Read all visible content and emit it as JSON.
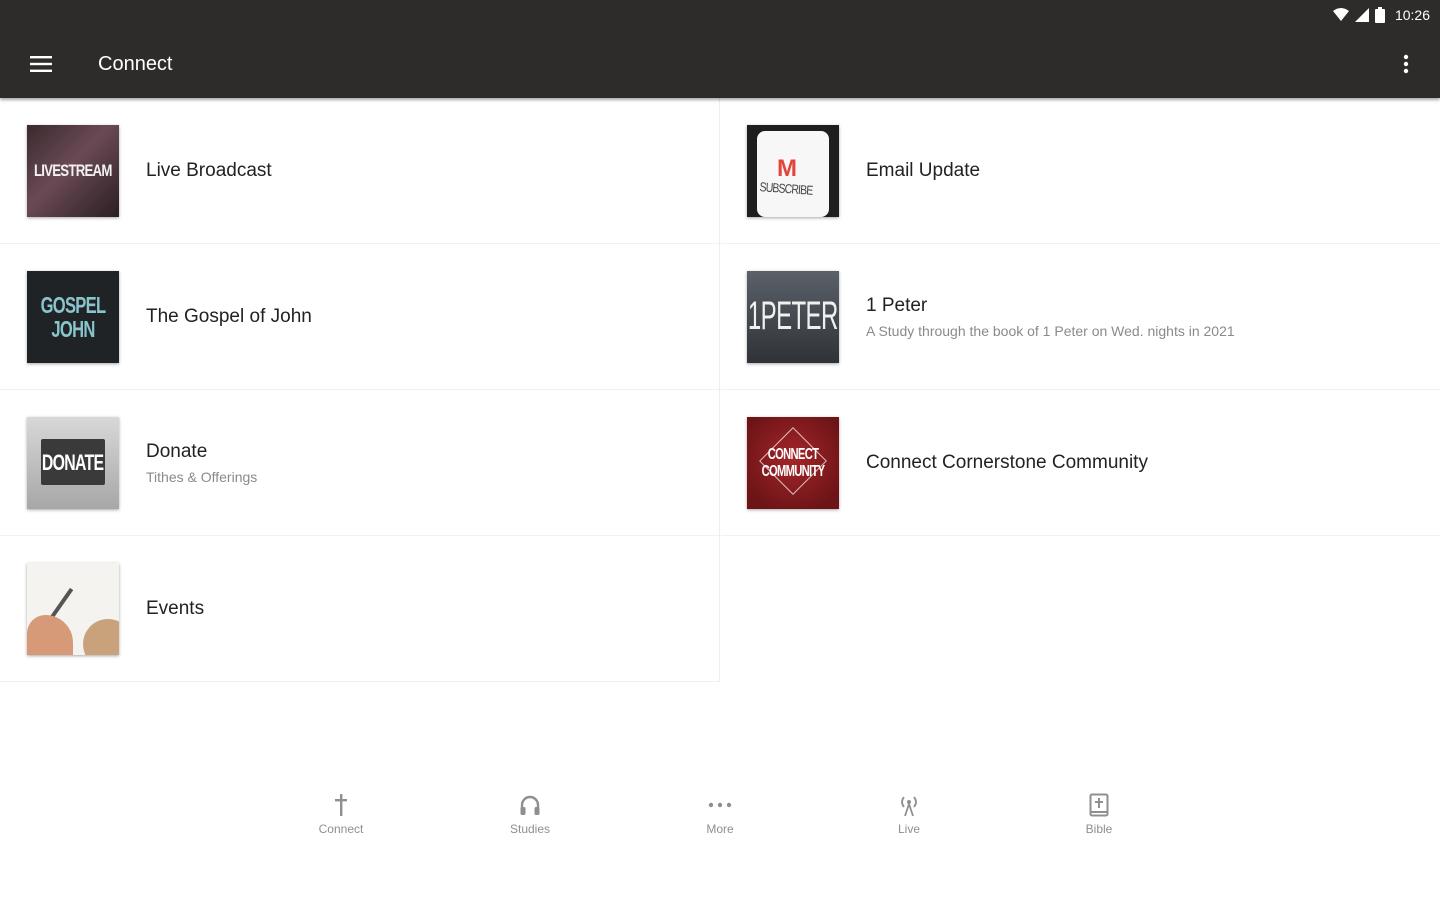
{
  "status_bar": {
    "time": "10:26"
  },
  "app_bar": {
    "title": "Connect",
    "menu_icon": "hamburger-menu-icon",
    "overflow_icon": "more-vertical-icon"
  },
  "items_left": [
    {
      "title": "Live Broadcast",
      "subtitle": "",
      "thumb_text": "LIVESTREAM"
    },
    {
      "title": "The Gospel of John",
      "subtitle": "",
      "thumb_text": "GOSPEL JOHN"
    },
    {
      "title": "Donate",
      "subtitle": "Tithes & Offerings",
      "thumb_text": "DONATE"
    },
    {
      "title": "Events",
      "subtitle": "",
      "thumb_text": ""
    }
  ],
  "items_right": [
    {
      "title": "Email Update",
      "subtitle": "",
      "thumb_text": "SUBSCRIBE"
    },
    {
      "title": "1 Peter",
      "subtitle": "A Study through the book of 1 Peter on Wed. nights in 2021",
      "thumb_text": "1PETER"
    },
    {
      "title": "Connect Cornerstone Community",
      "subtitle": "",
      "thumb_text": "CONNECT COMMUNITY"
    }
  ],
  "bottom_nav": [
    {
      "label": "Connect",
      "icon": "cross-icon"
    },
    {
      "label": "Studies",
      "icon": "headphones-icon"
    },
    {
      "label": "More",
      "icon": "more-horizontal-icon"
    },
    {
      "label": "Live",
      "icon": "broadcast-icon"
    },
    {
      "label": "Bible",
      "icon": "bible-icon"
    }
  ]
}
